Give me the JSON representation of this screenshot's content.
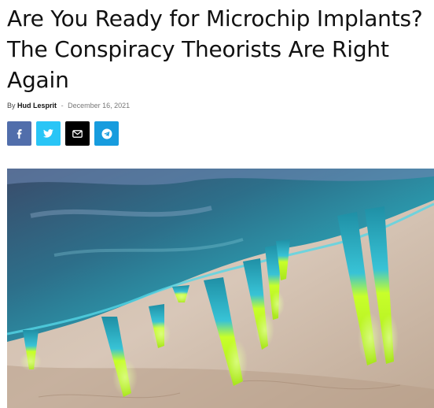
{
  "article": {
    "title": "Are You Ready for Microchip Implants? The Conspiracy Theorists Are Right Again",
    "byline_prefix": "By",
    "author": "Hud Lesprit",
    "separator": "-",
    "date": "December 16, 2021"
  },
  "share": {
    "buttons": [
      {
        "network": "facebook",
        "icon": "facebook-icon",
        "color": "#516eab"
      },
      {
        "network": "twitter",
        "icon": "twitter-icon",
        "color": "#29c5f6"
      },
      {
        "network": "email",
        "icon": "envelope-icon",
        "color": "#000000"
      },
      {
        "network": "telegram",
        "icon": "telegram-icon",
        "color": "#179cde"
      }
    ]
  },
  "colors": {
    "text": "#111111",
    "meta": "#777777",
    "patch_teal": "#2aa7b8",
    "needle_tip": "#c8ff2a"
  }
}
